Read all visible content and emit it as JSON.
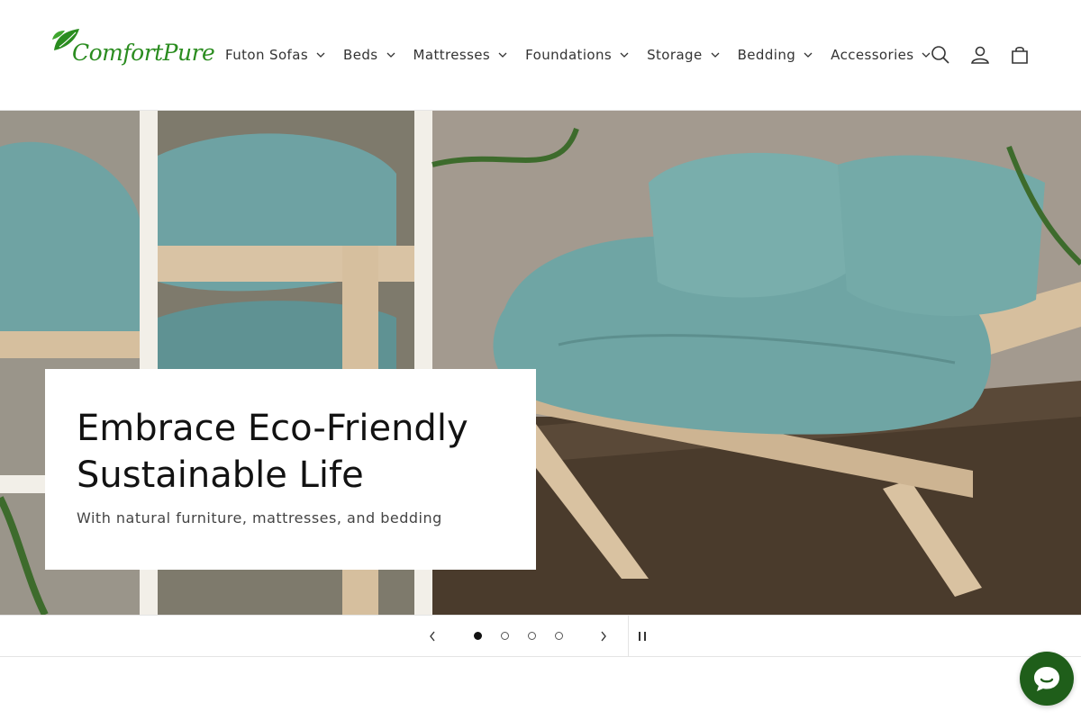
{
  "header": {
    "logo_text": "ComfortPure",
    "nav": [
      {
        "label": "Futon Sofas"
      },
      {
        "label": "Beds"
      },
      {
        "label": "Mattresses"
      },
      {
        "label": "Foundations"
      },
      {
        "label": "Storage"
      },
      {
        "label": "Bedding"
      },
      {
        "label": "Accessories"
      }
    ],
    "icons": [
      "search-icon",
      "account-icon",
      "cart-icon"
    ]
  },
  "hero": {
    "title": "Embrace Eco-Friendly Sustainable Life",
    "subtitle": "With natural furniture, mattresses, and bedding"
  },
  "slider": {
    "slide_count": 4,
    "active_index": 0
  },
  "colors": {
    "brand_green": "#2a8c1f",
    "chat_bg": "#1f5e1a",
    "cushion": "#6fa3a3"
  }
}
